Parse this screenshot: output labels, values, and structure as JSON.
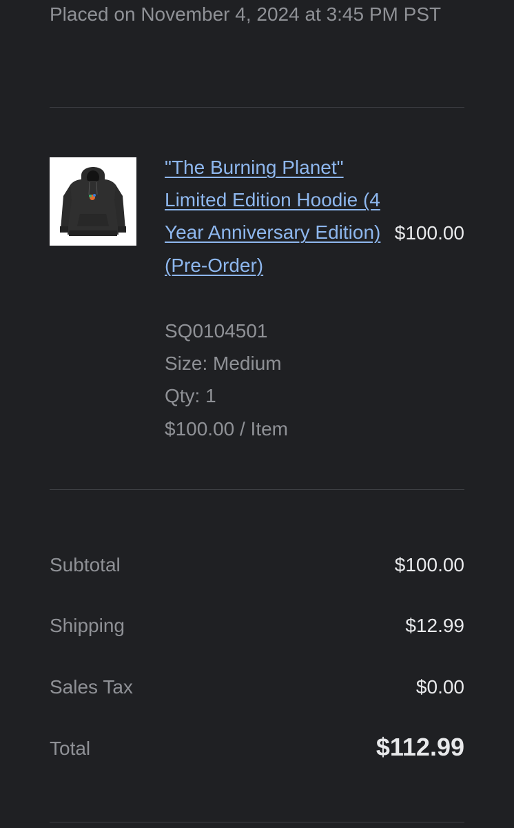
{
  "order": {
    "placed_text": "Placed on November 4, 2024 at 3:45 PM PST"
  },
  "item": {
    "title": "\"The Burning Planet\" Limited Edition Hoodie (4 Year Anniversary Edition) (Pre-Order)",
    "sku": "SQ0104501",
    "size": "Size: Medium",
    "qty": "Qty: 1",
    "unit_price": "$100.00 / Item",
    "price": "$100.00",
    "thumbnail": "hoodie-product-image"
  },
  "summary": {
    "subtotal_label": "Subtotal",
    "subtotal_value": "$100.00",
    "shipping_label": "Shipping",
    "shipping_value": "$12.99",
    "tax_label": "Sales Tax",
    "tax_value": "$0.00",
    "total_label": "Total",
    "total_value": "$112.99"
  },
  "colors": {
    "background": "#1f2023",
    "link": "#8eb7ee",
    "muted_text": "#8f9196",
    "primary_text": "#e8e9eb",
    "divider": "#3d3f44"
  }
}
